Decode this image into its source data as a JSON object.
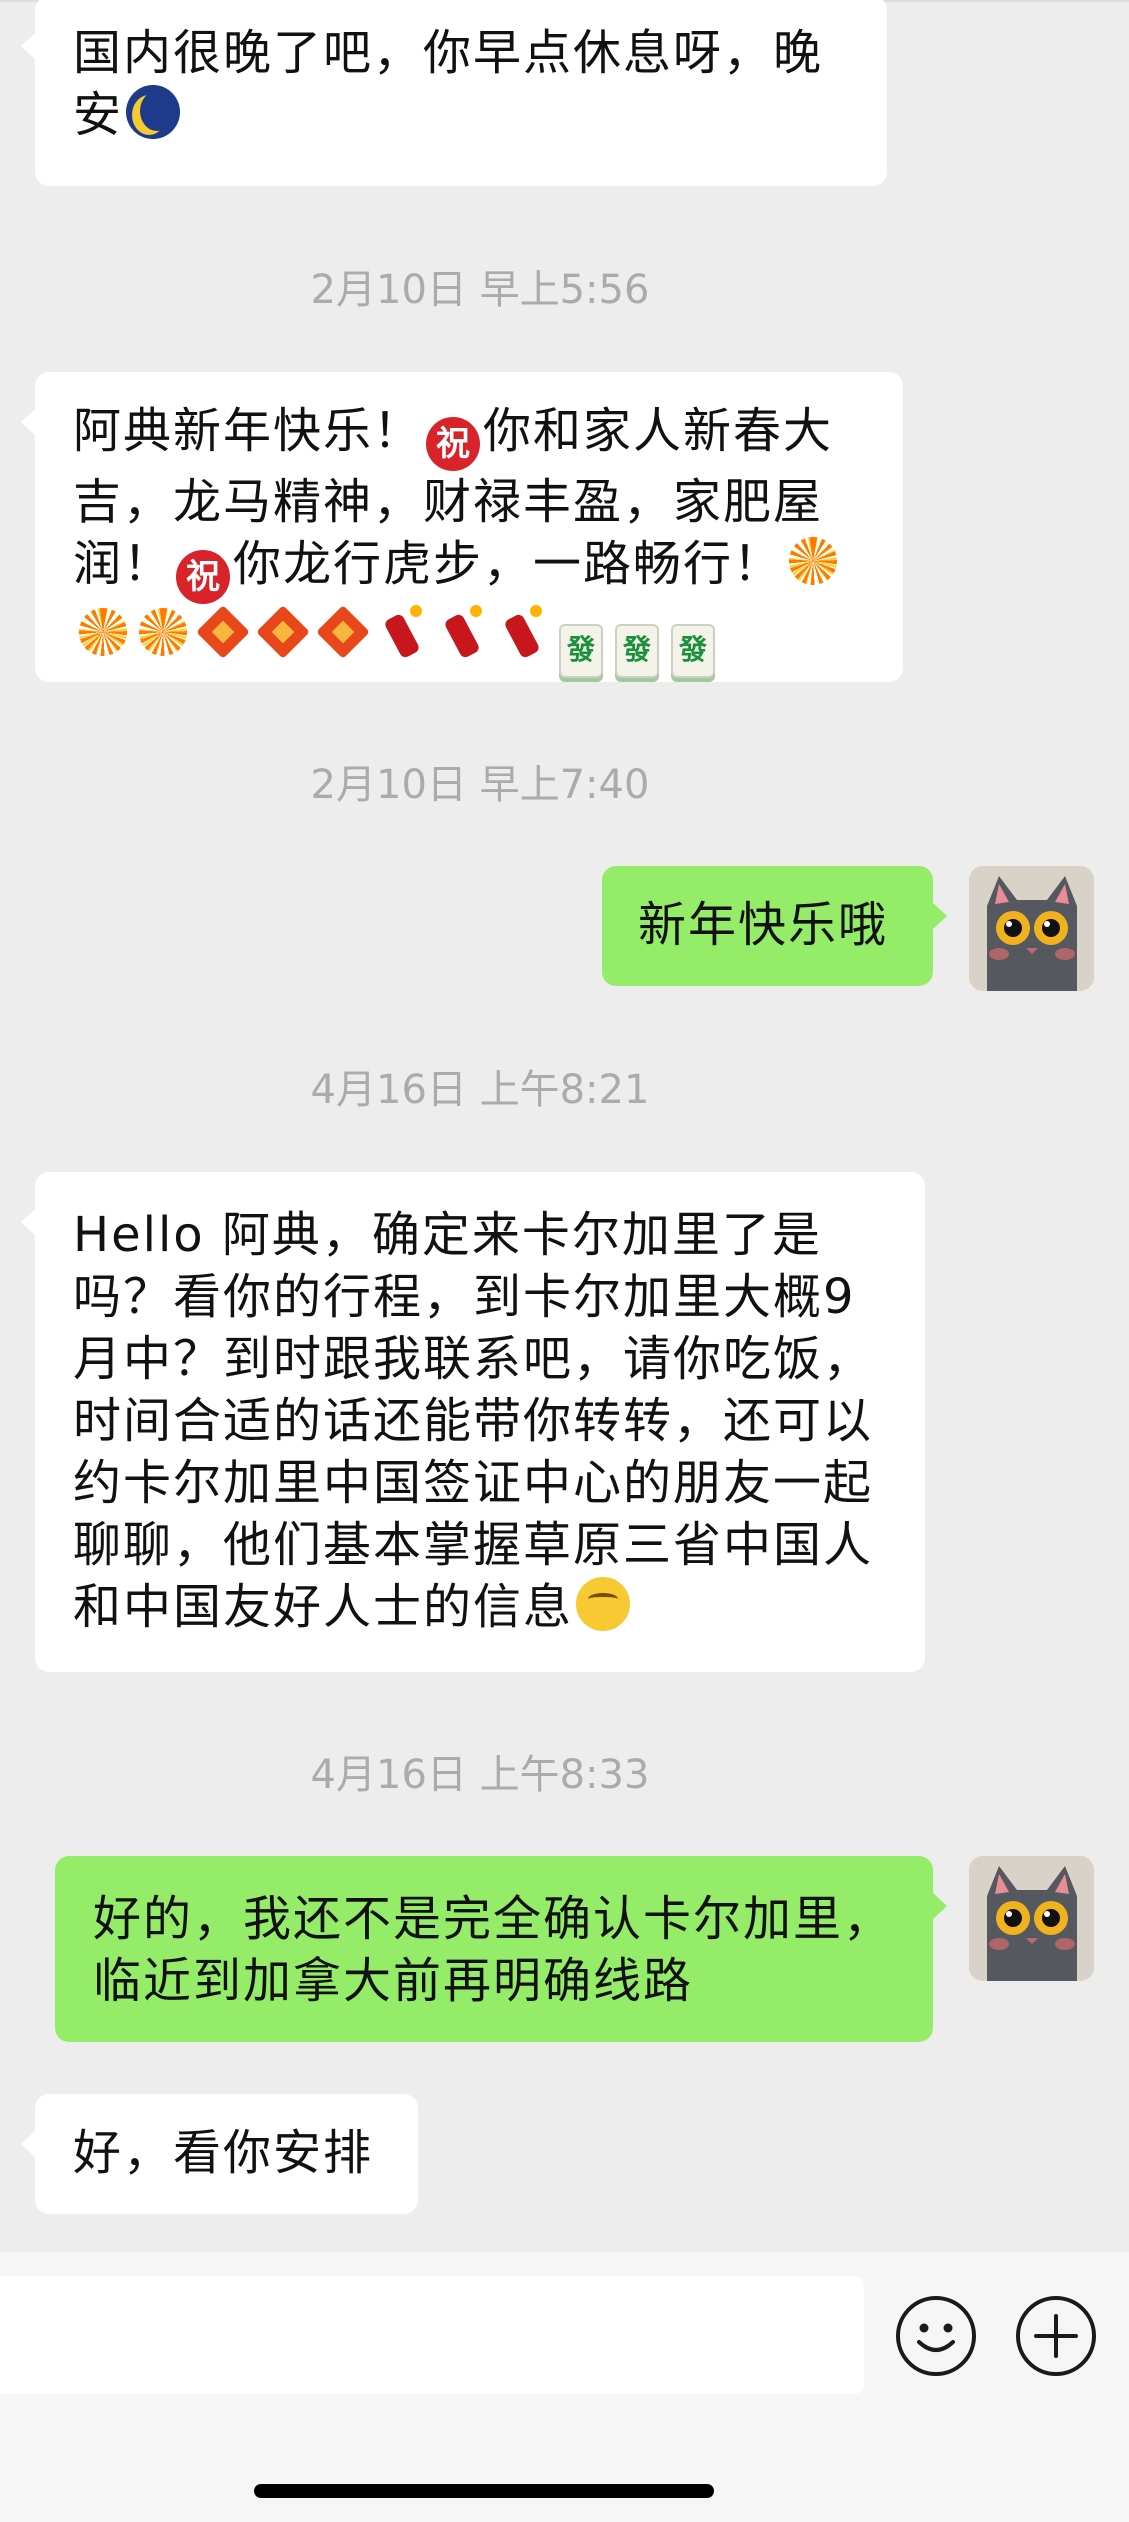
{
  "messages": [
    {
      "kind": "in",
      "text": "国内很晚了吧，你早点休息呀，晚安",
      "emoji": [
        "moon-face-icon"
      ]
    },
    {
      "kind": "time",
      "text": "2月10日 早上5:56"
    },
    {
      "kind": "in",
      "text_parts": [
        "阿典新年快乐！",
        "你和家人新春大吉，龙马精神，财禄丰盈，家肥屋润！",
        "你龙行虎步，一路畅行！"
      ],
      "emoji": [
        "congratulation-icon",
        "fireworks-icon",
        "fu-decoration-icon",
        "firecracker-icon",
        "mahjong-fa-icon"
      ],
      "mahjong_char": "發"
    },
    {
      "kind": "time",
      "text": "2月10日 早上7:40"
    },
    {
      "kind": "out",
      "text": "新年快乐哦",
      "avatar": "cat-avatar"
    },
    {
      "kind": "time",
      "text": "4月16日 上午8:21"
    },
    {
      "kind": "in",
      "text": "Hello 阿典，确定来卡尔加里了是吗？看你的行程，到卡尔加里大概9月中？到时跟我联系吧，请你吃饭，时间合适的话还能带你转转，还可以约卡尔加里中国签证中心的朋友一起聊聊，他们基本掌握草原三省中国人和中国友好人士的信息",
      "emoji": [
        "thinking-face-icon"
      ]
    },
    {
      "kind": "time",
      "text": "4月16日 上午8:33"
    },
    {
      "kind": "out",
      "text": "好的，我还不是完全确认卡尔加里，临近到加拿大前再明确线路",
      "avatar": "cat-avatar"
    },
    {
      "kind": "in",
      "text": "好，看你安排"
    }
  ],
  "zhu_char": "祝",
  "input": {
    "placeholder": "",
    "emoji_button": "smiley-icon",
    "plus_button": "plus-icon"
  },
  "colors": {
    "background": "#ededed",
    "incoming_bubble": "#ffffff",
    "outgoing_bubble": "#95ec69",
    "timestamp": "#ababab"
  }
}
